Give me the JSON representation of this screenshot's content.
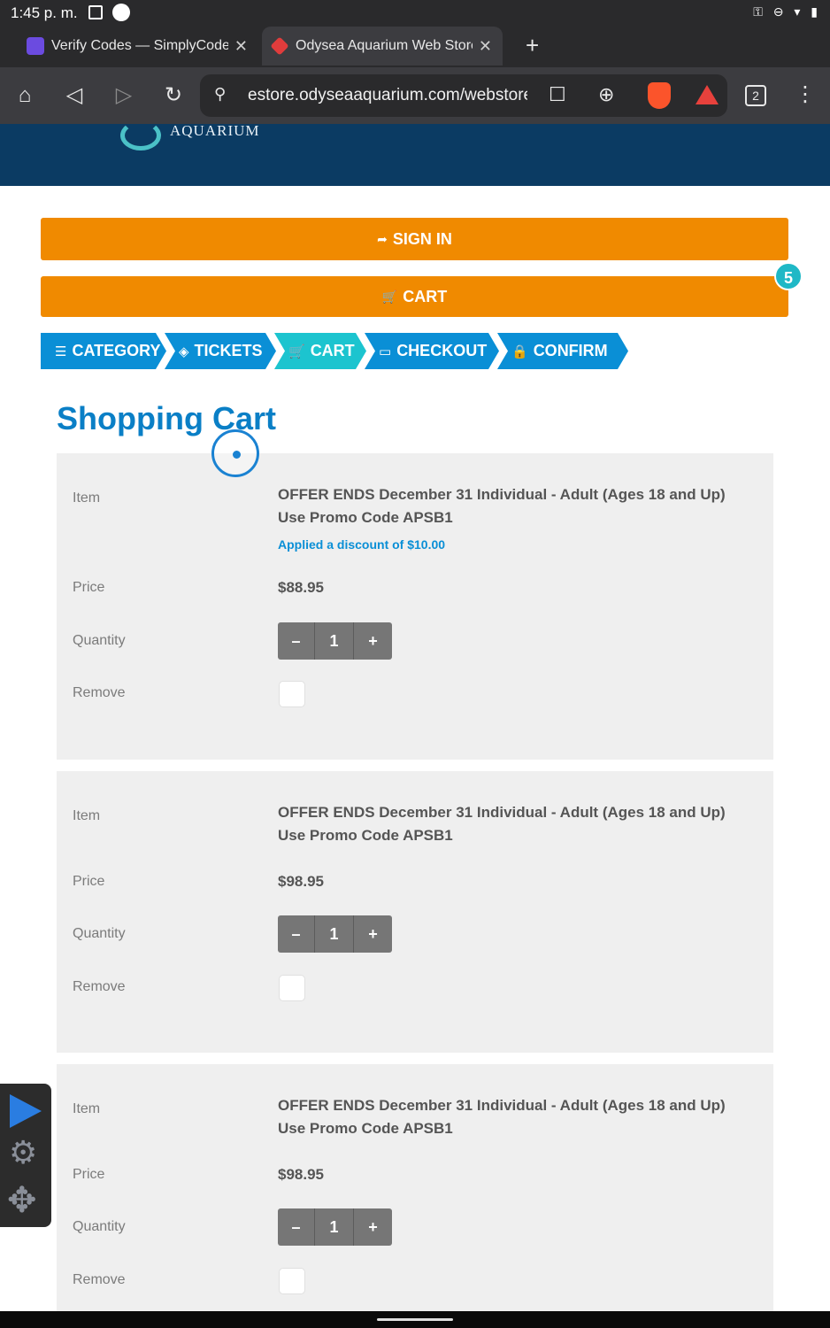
{
  "status": {
    "time": "1:45 p. m.",
    "right_icons": "⚿ ⊖ ▾ ▮"
  },
  "tabs": [
    {
      "title": "Verify Codes — SimplyCodes",
      "close": "✕"
    },
    {
      "title": "Odysea Aquarium Web Store",
      "close": "✕"
    }
  ],
  "toolbar": {
    "url": "estore.odyseaaquarium.com/webstore",
    "tab_count": "2",
    "icons": {
      "home": "⌂",
      "back": "◁",
      "forward": "▷",
      "reload": "↻",
      "site_settings": "⚲",
      "bookmark": "☐",
      "download": "⊕",
      "menu": "⋮",
      "new_tab": "+"
    }
  },
  "site": {
    "logo_text": "AQUARIUM"
  },
  "buttons": {
    "sign_in": "SIGN IN",
    "cart": "CART",
    "cart_count": "5"
  },
  "steps": [
    {
      "label": "CATEGORY",
      "icon": "☰"
    },
    {
      "label": "TICKETS",
      "icon": "◈"
    },
    {
      "label": "CART",
      "icon": "🛒"
    },
    {
      "label": "CHECKOUT",
      "icon": "▭"
    },
    {
      "label": "CONFIRM",
      "icon": "🔒"
    }
  ],
  "colors": {
    "accent_orange": "#f08a00",
    "step_blue": "#0a8fd6",
    "step_active": "#1cc4cf",
    "header_navy": "#0b3b63",
    "title_blue": "#0a7fc6"
  },
  "page_title": "Shopping Cart",
  "labels": {
    "item": "Item",
    "price": "Price",
    "quantity": "Quantity",
    "remove": "Remove",
    "minus": "–",
    "plus": "+"
  },
  "cart_items": [
    {
      "name": "OFFER ENDS December 31 Individual - Adult (Ages 18 and Up) Use Promo Code APSB1",
      "discount": "Applied a discount of $10.00",
      "price": "$88.95",
      "quantity": "1"
    },
    {
      "name": "OFFER ENDS December 31 Individual - Adult (Ages 18 and Up) Use Promo Code APSB1",
      "price": "$98.95",
      "quantity": "1"
    },
    {
      "name": "OFFER ENDS December 31 Individual - Adult (Ages 18 and Up) Use Promo Code APSB1",
      "price": "$98.95",
      "quantity": "1"
    }
  ],
  "floating_toolbar": {
    "gear": "⚙",
    "move": "✥"
  }
}
